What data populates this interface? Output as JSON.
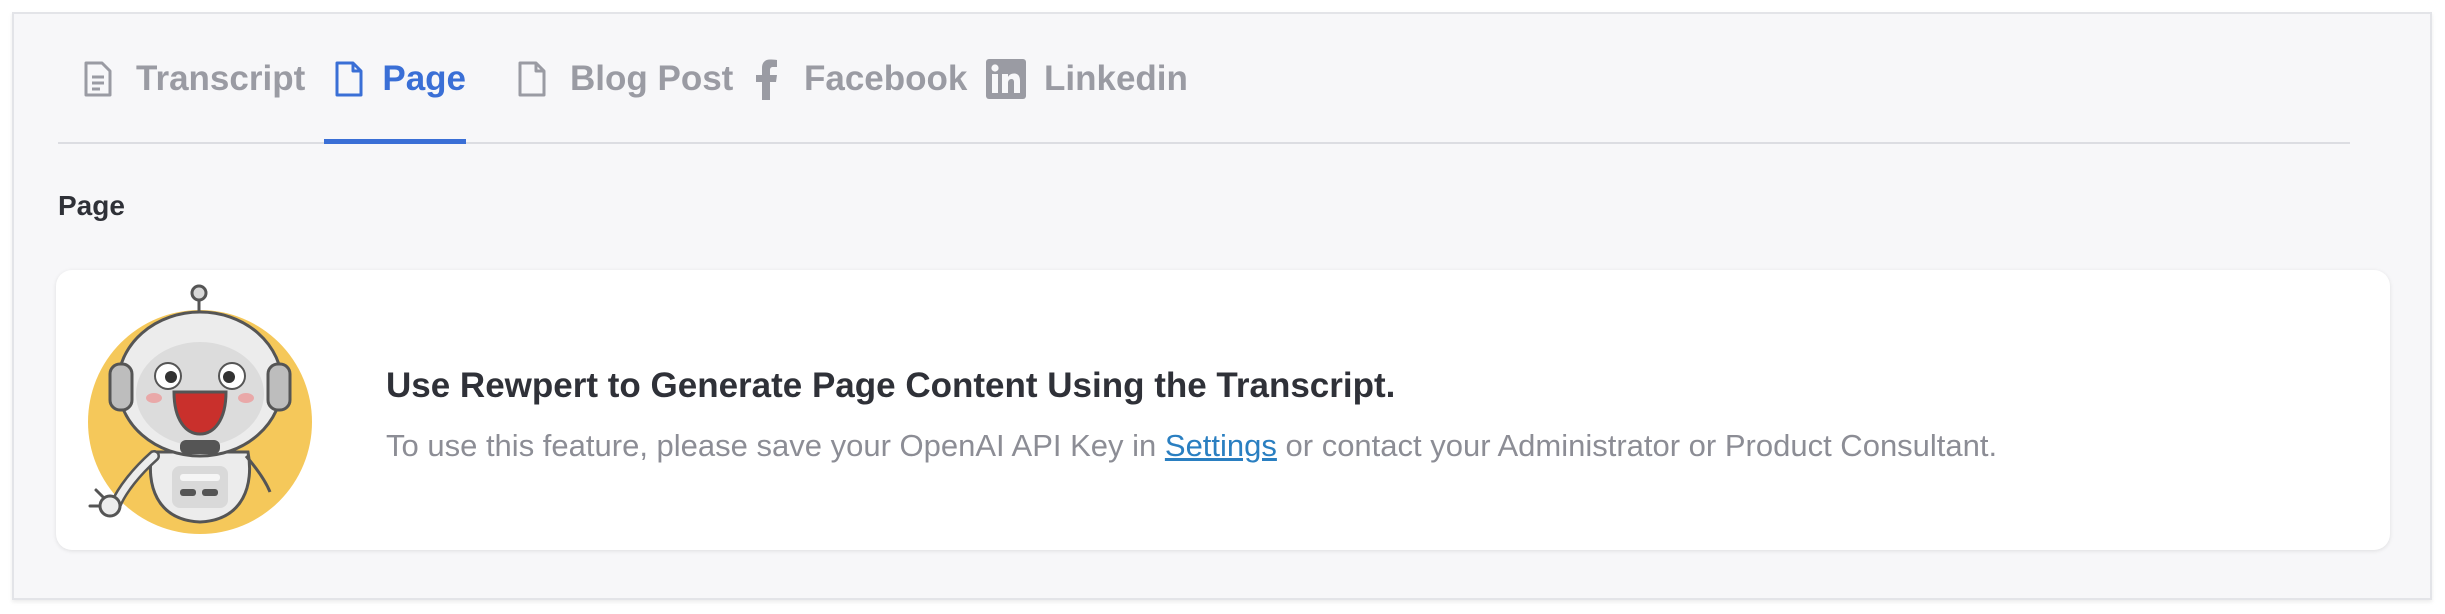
{
  "tabs": [
    {
      "label": "Transcript",
      "icon": "document-lines-icon",
      "active": false
    },
    {
      "label": "Page",
      "icon": "document-icon",
      "active": true
    },
    {
      "label": "Blog Post",
      "icon": "document-icon",
      "active": false
    },
    {
      "label": "Facebook",
      "icon": "facebook-icon",
      "active": false
    },
    {
      "label": "Linkedin",
      "icon": "linkedin-icon",
      "active": false
    }
  ],
  "section": {
    "title": "Page"
  },
  "card": {
    "heading": "Use Rewpert to Generate Page Content Using the Transcript.",
    "text_before": "To use this feature, please save your OpenAI API Key in ",
    "link_label": "Settings",
    "text_after": " or contact your Administrator or Product Consultant."
  },
  "colors": {
    "accent": "#3a6fd6",
    "tab_inactive": "#9a9ba3",
    "link": "#2a7fc1",
    "heading": "#2f3138",
    "body_text": "#8c8d95",
    "robot_halo": "#f5c85a",
    "robot_mouth": "#c9302c"
  }
}
